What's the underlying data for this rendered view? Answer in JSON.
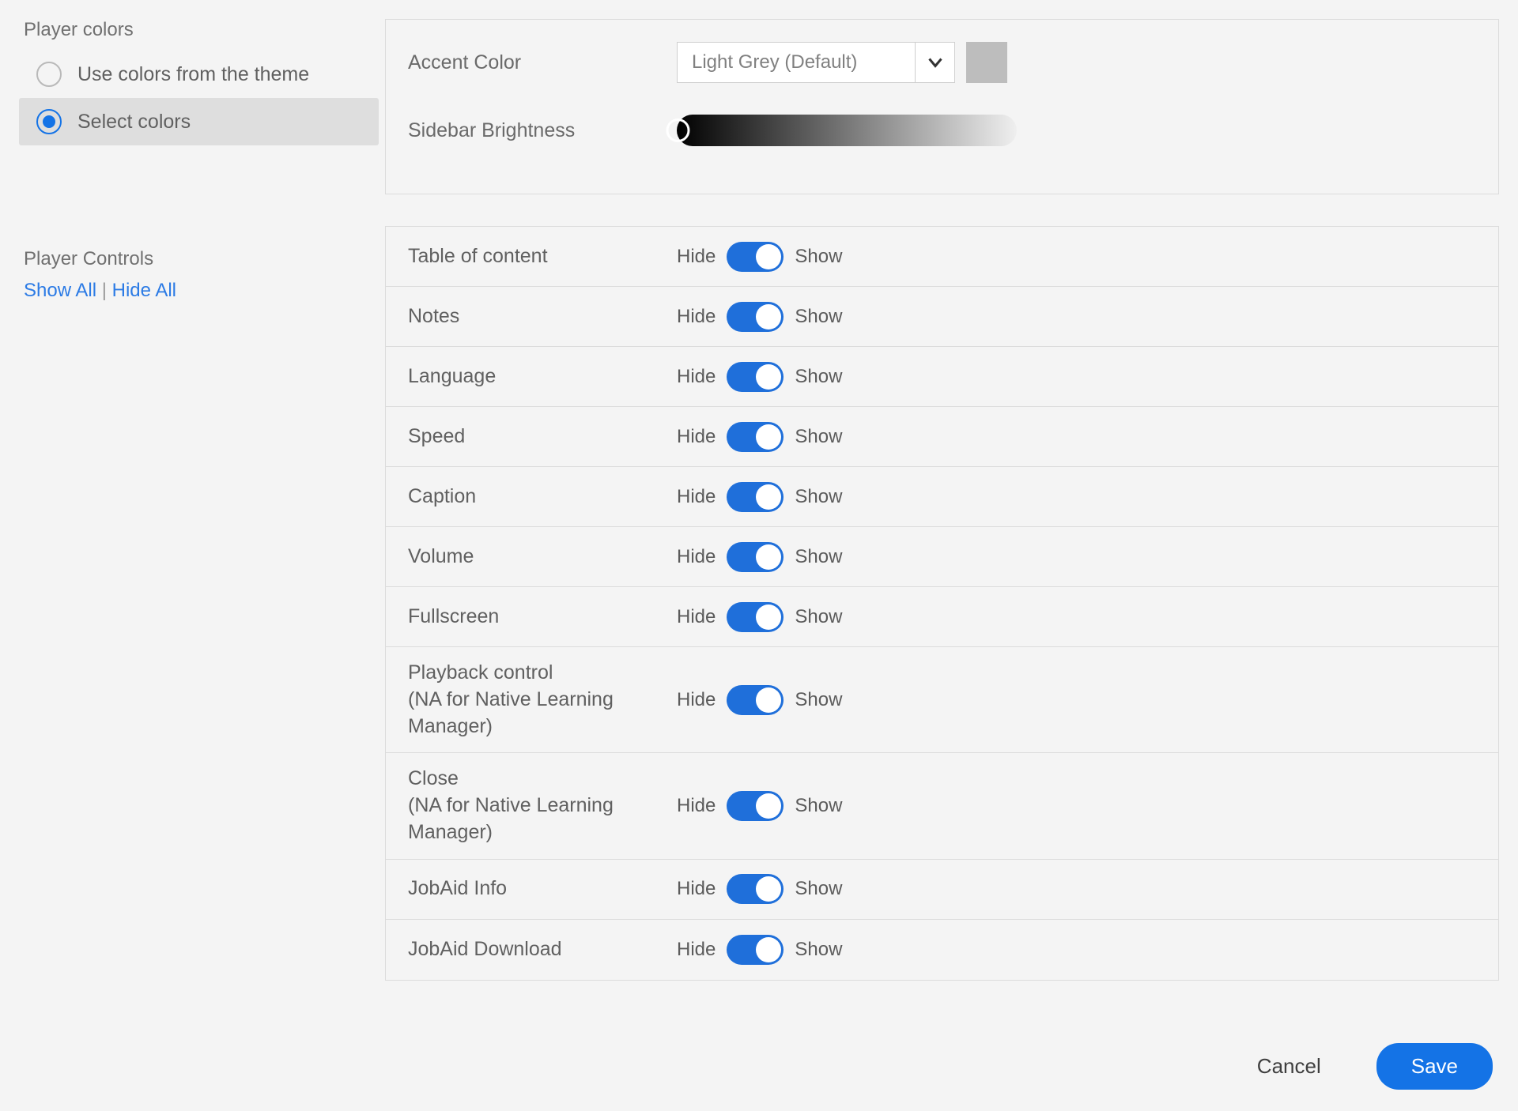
{
  "sidebar": {
    "player_colors_title": "Player colors",
    "radio_theme_label": "Use colors from the theme",
    "radio_select_label": "Select colors",
    "player_controls_title": "Player Controls",
    "show_all": "Show All",
    "sep": " | ",
    "hide_all": "Hide All"
  },
  "colors_panel": {
    "accent_label": "Accent Color",
    "accent_value": "Light Grey (Default)",
    "brightness_label": "Sidebar Brightness"
  },
  "toggle_text": {
    "hide": "Hide",
    "show": "Show"
  },
  "controls": {
    "items": [
      {
        "label": "Table of content"
      },
      {
        "label": "Notes"
      },
      {
        "label": "Language"
      },
      {
        "label": "Speed"
      },
      {
        "label": "Caption"
      },
      {
        "label": "Volume"
      },
      {
        "label": "Fullscreen"
      },
      {
        "label": "Playback control\n(NA for Native Learning Manager)"
      },
      {
        "label": "Close\n(NA for Native Learning Manager)"
      },
      {
        "label": "JobAid Info"
      },
      {
        "label": "JobAid Download"
      }
    ]
  },
  "footer": {
    "cancel": "Cancel",
    "save": "Save"
  }
}
